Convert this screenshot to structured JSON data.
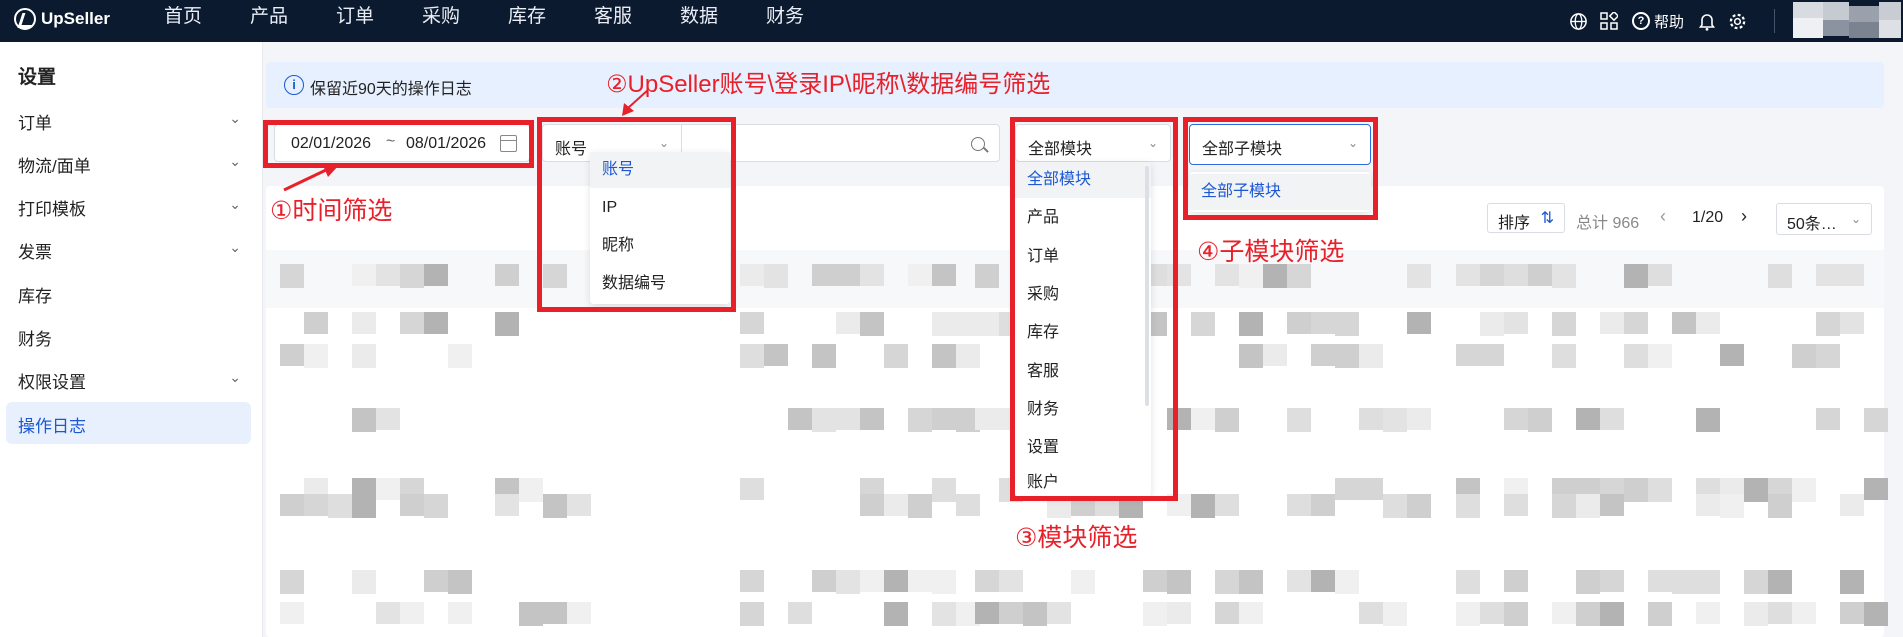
{
  "topbar": {
    "brand": "UpSeller",
    "nav": [
      "首页",
      "产品",
      "订单",
      "采购",
      "库存",
      "客服",
      "数据",
      "财务"
    ],
    "help_label": "帮助",
    "icons": [
      "globe-icon",
      "apps-grid-icon",
      "help-icon",
      "bell-icon",
      "gear-icon"
    ]
  },
  "sidebar": {
    "title": "设置",
    "items": [
      {
        "label": "订单",
        "expandable": true
      },
      {
        "label": "物流/面单",
        "expandable": true
      },
      {
        "label": "打印模板",
        "expandable": true
      },
      {
        "label": "发票",
        "expandable": true
      },
      {
        "label": "库存",
        "expandable": false
      },
      {
        "label": "财务",
        "expandable": false
      },
      {
        "label": "权限设置",
        "expandable": true
      },
      {
        "label": "操作日志",
        "expandable": false,
        "active": true
      }
    ]
  },
  "banner": {
    "text": "保留近90天的操作日志"
  },
  "filters": {
    "date_start": "02/01/2026",
    "date_sep": "~",
    "date_end": "08/01/2026",
    "search_type": "账号",
    "search_value": "",
    "module": "全部模块",
    "submodule": "全部子模块"
  },
  "search_type_options": [
    {
      "label": "账号",
      "selected": true
    },
    {
      "label": "IP"
    },
    {
      "label": "昵称"
    },
    {
      "label": "数据编号"
    }
  ],
  "module_options": [
    {
      "label": "全部模块",
      "selected": true
    },
    {
      "label": "产品"
    },
    {
      "label": "订单"
    },
    {
      "label": "采购"
    },
    {
      "label": "库存"
    },
    {
      "label": "客服"
    },
    {
      "label": "财务"
    },
    {
      "label": "设置"
    },
    {
      "label": "账户"
    }
  ],
  "submodule_options": [
    {
      "label": "全部子模块",
      "selected": true
    }
  ],
  "toolbar": {
    "sort_label": "排序",
    "total": "总计 966",
    "page": "1/20",
    "page_size": "50条…"
  },
  "annotations": {
    "a1": "①时间筛选",
    "a2": "②UpSeller账号\\登录IP\\昵称\\数据编号筛选",
    "a3": "③模块筛选",
    "a4": "④子模块筛选",
    "color": "#e8202a"
  },
  "colors": {
    "topbar": "#0b1a2f",
    "accent": "#1c58d4",
    "banner": "#e6f0fe"
  }
}
